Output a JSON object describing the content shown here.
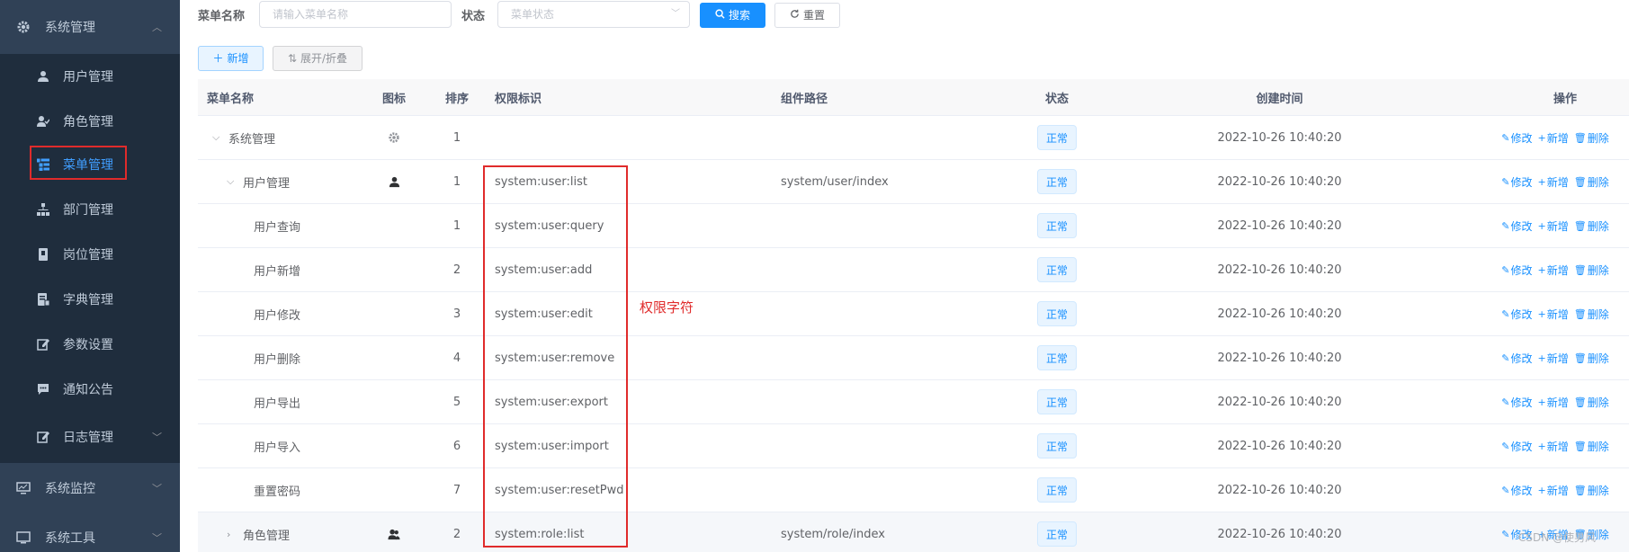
{
  "sidebar": {
    "group_system": {
      "label": "系统管理",
      "icon": "gear-icon",
      "arrow": "chevron-up-icon"
    },
    "items": [
      {
        "label": "用户管理",
        "icon": "user-icon"
      },
      {
        "label": "角色管理",
        "icon": "peoples-icon"
      },
      {
        "label": "菜单管理",
        "icon": "tree-table-icon",
        "active": true
      },
      {
        "label": "部门管理",
        "icon": "tree-icon"
      },
      {
        "label": "岗位管理",
        "icon": "post-icon"
      },
      {
        "label": "字典管理",
        "icon": "dict-icon"
      },
      {
        "label": "参数设置",
        "icon": "edit-icon"
      },
      {
        "label": "通知公告",
        "icon": "message-icon"
      },
      {
        "label": "日志管理",
        "icon": "log-icon",
        "arrow": "chevron-down-icon"
      }
    ],
    "group_monitor": {
      "label": "系统监控",
      "icon": "monitor-icon",
      "arrow": "chevron-down-icon"
    },
    "group_tool": {
      "label": "系统工具",
      "icon": "tool-icon",
      "arrow": "chevron-down-icon"
    }
  },
  "search": {
    "menu_name_label": "菜单名称",
    "menu_name_placeholder": "请输入菜单名称",
    "status_label": "状态",
    "status_placeholder": "菜单状态",
    "search_button": "搜索",
    "reset_button": "重置"
  },
  "toolbar": {
    "add_button": "新增",
    "expand_button": "展开/折叠"
  },
  "table": {
    "columns": [
      "菜单名称",
      "图标",
      "排序",
      "权限标识",
      "组件路径",
      "状态",
      "创建时间",
      "操作"
    ],
    "rows": [
      {
        "name": "系统管理",
        "caret": "⌵",
        "icon": "gear-icon",
        "order": "1",
        "perm": "",
        "component": "",
        "status": "正常",
        "time": "2022-10-26 10:40:20"
      },
      {
        "name": "用户管理",
        "caret": "⌵",
        "icon": "user-icon",
        "order": "1",
        "perm": "system:user:list",
        "component": "system/user/index",
        "status": "正常",
        "time": "2022-10-26 10:40:20"
      },
      {
        "name": "用户查询",
        "order": "1",
        "perm": "system:user:query",
        "component": "",
        "status": "正常",
        "time": "2022-10-26 10:40:20"
      },
      {
        "name": "用户新增",
        "order": "2",
        "perm": "system:user:add",
        "component": "",
        "status": "正常",
        "time": "2022-10-26 10:40:20"
      },
      {
        "name": "用户修改",
        "order": "3",
        "perm": "system:user:edit",
        "component": "",
        "status": "正常",
        "time": "2022-10-26 10:40:20"
      },
      {
        "name": "用户删除",
        "order": "4",
        "perm": "system:user:remove",
        "component": "",
        "status": "正常",
        "time": "2022-10-26 10:40:20"
      },
      {
        "name": "用户导出",
        "order": "5",
        "perm": "system:user:export",
        "component": "",
        "status": "正常",
        "time": "2022-10-26 10:40:20"
      },
      {
        "name": "用户导入",
        "order": "6",
        "perm": "system:user:import",
        "component": "",
        "status": "正常",
        "time": "2022-10-26 10:40:20"
      },
      {
        "name": "重置密码",
        "order": "7",
        "perm": "system:user:resetPwd",
        "component": "",
        "status": "正常",
        "time": "2022-10-26 10:40:20"
      },
      {
        "name": "角色管理",
        "caret": "›",
        "icon": "peoples-icon",
        "order": "2",
        "perm": "system:role:list",
        "component": "system/role/index",
        "status": "正常",
        "time": "2022-10-26 10:40:20"
      }
    ],
    "ops": {
      "edit": "修改",
      "add": "新增",
      "delete": "删除"
    }
  },
  "annotation": {
    "note": "权限字符"
  },
  "watermark": "CSDN @使男风",
  "colors": {
    "sidebar_bg": "#1f2d3d",
    "group_bg": "#304156",
    "accent": "#1890ff",
    "highlight": "#e02b2b"
  }
}
